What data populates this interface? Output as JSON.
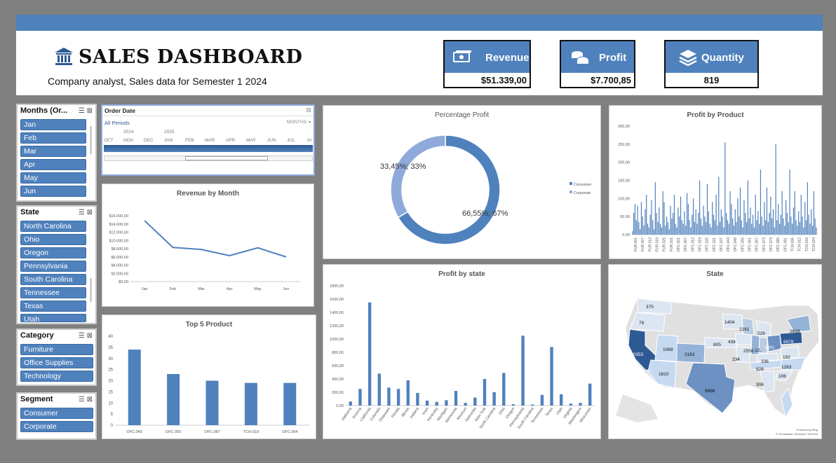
{
  "header": {
    "title": "SALES DASHBOARD",
    "subtitle": "Company analyst, Sales data for Semester 1 2024"
  },
  "kpis": {
    "revenue": {
      "label": "Revenue",
      "value": "$51.339,00",
      "icon": "money-icon"
    },
    "profit": {
      "label": "Profit",
      "value": "$7.700,85",
      "icon": "coins-icon"
    },
    "quantity": {
      "label": "Quantity",
      "value": "819",
      "icon": "stack-icon"
    }
  },
  "slicers": {
    "months": {
      "title": "Months (Or...",
      "items": [
        "Jan",
        "Feb",
        "Mar",
        "Apr",
        "May",
        "Jun"
      ]
    },
    "state": {
      "title": "State",
      "items": [
        "North Carolina",
        "Ohio",
        "Oregon",
        "Pennsylvania",
        "South Carolina",
        "Tennessee",
        "Texas",
        "Utah"
      ]
    },
    "category": {
      "title": "Category",
      "items": [
        "Furniture",
        "Office Supplies",
        "Technology"
      ]
    },
    "segment": {
      "title": "Segment",
      "items": [
        "Consumer",
        "Corporate"
      ]
    }
  },
  "timeline": {
    "title": "Order Date",
    "period": "All Periods",
    "level": "MONTHS",
    "years": [
      "2024",
      "2025"
    ],
    "months": [
      "OCT",
      "NOV",
      "DEC",
      "JAN",
      "FEB",
      "MAR",
      "APR",
      "MAY",
      "JUN",
      "JUL",
      "AI"
    ]
  },
  "colors": {
    "accent": "#4f81bd",
    "light": "#8eaadb",
    "dark": "#2e5a94"
  },
  "charts": {
    "percentage_profit": {
      "title": "Percentage Profit",
      "chart_data": {
        "type": "pie",
        "slices": [
          {
            "name": "Consumer",
            "value": 66.55,
            "label": "66,55%; 67%"
          },
          {
            "name": "Corporate",
            "value": 33.45,
            "label": "33,45%; 33%"
          }
        ],
        "legend": "right"
      }
    },
    "revenue_by_month": {
      "title": "Revenue by Month",
      "chart_data": {
        "type": "line",
        "categories": [
          "Jan",
          "Feb",
          "Mar",
          "Apr",
          "May",
          "Jun"
        ],
        "values": [
          14800,
          8300,
          7800,
          6300,
          8200,
          6000
        ],
        "ylim": [
          0,
          16000
        ],
        "yticks": [
          "$0,00",
          "$2.000,00",
          "$4.000,00",
          "$6.000,00",
          "$8.000,00",
          "$10.000,00",
          "$12.000,00",
          "$14.000,00",
          "$16.000,00"
        ]
      }
    },
    "top5_product": {
      "title": "Top 5 Product",
      "chart_data": {
        "type": "bar",
        "categories": [
          "OFC.043",
          "OFC.050",
          "OFC.087",
          "TCH.019",
          "OFC.064"
        ],
        "values": [
          34,
          23,
          20,
          19,
          19
        ],
        "ylim": [
          0,
          40
        ],
        "yticks": [
          "0",
          "5",
          "10",
          "15",
          "20",
          "25",
          "30",
          "35",
          "40"
        ]
      }
    },
    "profit_by_state": {
      "title": "Profit by state",
      "chart_data": {
        "type": "bar",
        "categories": [
          "Alabama",
          "Arizona",
          "California",
          "Colorado",
          "Delaware",
          "Florida",
          "Illinois",
          "Indiana",
          "Iowa",
          "Kentucky",
          "Michigan",
          "Minnesota",
          "Missouri",
          "Nebraska",
          "New York",
          "North Carolina",
          "Ohio",
          "Oregon",
          "Pennsylvania",
          "South Carolina",
          "Tennessee",
          "Texas",
          "Utah",
          "Virginia",
          "Washington",
          "Wisconsin"
        ],
        "values": [
          60,
          250,
          1550,
          480,
          270,
          250,
          380,
          190,
          75,
          55,
          80,
          220,
          40,
          120,
          400,
          200,
          490,
          20,
          1050,
          15,
          160,
          880,
          170,
          30,
          40,
          330
        ],
        "ylim": [
          0,
          1800
        ],
        "yticks": [
          "0,00",
          "200,00",
          "400,00",
          "600,00",
          "800,00",
          "1000,00",
          "1200,00",
          "1400,00",
          "1600,00",
          "1800,00"
        ]
      }
    },
    "profit_by_product": {
      "title": "Profit by Product",
      "chart_data": {
        "type": "bar",
        "ylim": [
          0,
          300
        ],
        "yticks": [
          "0,00",
          "50,00",
          "100,00",
          "150,00",
          "200,00",
          "250,00",
          "300,00"
        ],
        "xticks": [
          "FUR.001",
          "FUR.007",
          "FUR.013",
          "FUR.019",
          "FUR.025",
          "FUR.031",
          "OFC.001",
          "OFC.007",
          "OFC.013",
          "OFC.019",
          "OFC.025",
          "OFC.031",
          "OFC.037",
          "OFC.043",
          "OFC.049",
          "OFC.055",
          "OFC.061",
          "OFC.067",
          "OFC.073",
          "OFC.079",
          "OFC.085",
          "OFC.091",
          "TCH.006",
          "TCH.012",
          "TCH.018",
          "TCH.024"
        ],
        "values": [
          10,
          60,
          85,
          40,
          80,
          35,
          15,
          90,
          50,
          25,
          70,
          110,
          30,
          20,
          55,
          95,
          40,
          15,
          145,
          60,
          35,
          75,
          30,
          20,
          120,
          90,
          25,
          50,
          35,
          15,
          80,
          45,
          60,
          110,
          30,
          20,
          75,
          50,
          105,
          40,
          30,
          65,
          25,
          115,
          85,
          40,
          20,
          55,
          100,
          35,
          70,
          30,
          60,
          150,
          45,
          25,
          80,
          50,
          35,
          140,
          65,
          30,
          20,
          90,
          55,
          40,
          110,
          25,
          160,
          35,
          70,
          50,
          20,
          255,
          60,
          40,
          30,
          120,
          85,
          45,
          25,
          70,
          35,
          100,
          50,
          130,
          40,
          20,
          95,
          60,
          35,
          150,
          45,
          75,
          30,
          55,
          20,
          110,
          40,
          65,
          30,
          180,
          50,
          25,
          90,
          40,
          130,
          35,
          60,
          105,
          45,
          70,
          20,
          250,
          40,
          85,
          30,
          55,
          120,
          45,
          25,
          95,
          60,
          35,
          180,
          50,
          30,
          75,
          120,
          40,
          25,
          65,
          35,
          110,
          50,
          20,
          90,
          40,
          145,
          55,
          30,
          70,
          25,
          120,
          45,
          20
        ]
      }
    },
    "state_map": {
      "title": "State",
      "credits": [
        "Powered by Bing",
        "© GeoNames, Microsoft, TomTom"
      ],
      "labels": [
        {
          "state": "California",
          "value": "10353"
        },
        {
          "state": "Washington",
          "value": "375"
        },
        {
          "state": "Oregon",
          "value": "79"
        },
        {
          "state": "Utah",
          "value": "1069"
        },
        {
          "state": "Colorado",
          "value": "3163"
        },
        {
          "state": "Arizona",
          "value": "1610"
        },
        {
          "state": "Texas",
          "value": "5866"
        },
        {
          "state": "Nebraska",
          "value": "805"
        },
        {
          "state": "Minnesota",
          "value": "1404"
        },
        {
          "state": "Wisconsin",
          "value": "2161"
        },
        {
          "state": "Iowa",
          "value": "438"
        },
        {
          "state": "Missouri",
          "value": "234"
        },
        {
          "state": "Illinois",
          "value": "2556"
        },
        {
          "state": "Indiana",
          "value": "12.."
        },
        {
          "state": "Michigan",
          "value": "529"
        },
        {
          "state": "Ohio",
          "value": "3241"
        },
        {
          "state": "Pennsylvania",
          "value": "6978"
        },
        {
          "state": "New York",
          "value": "2618"
        },
        {
          "state": "Virginia",
          "value": "192"
        },
        {
          "state": "Kentucky",
          "value": "336"
        },
        {
          "state": "Tennessee",
          "value": "928"
        },
        {
          "state": "North Carolina",
          "value": "1283"
        },
        {
          "state": "South Carolina",
          "value": "106"
        },
        {
          "state": "Alabama",
          "value": "306"
        }
      ]
    }
  }
}
